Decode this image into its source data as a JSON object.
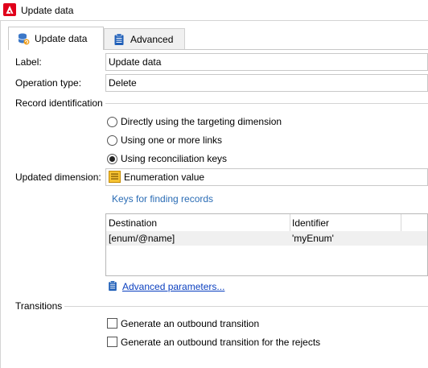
{
  "window": {
    "title": "Update data"
  },
  "tabs": [
    {
      "label": "Update data",
      "icon": "database-update-icon",
      "active": true
    },
    {
      "label": "Advanced",
      "icon": "clipboard-icon",
      "active": false
    }
  ],
  "form": {
    "label_caption": "Label:",
    "label_value": "Update data",
    "operation_caption": "Operation type:",
    "operation_value": "Delete"
  },
  "record_identification": {
    "title": "Record identification",
    "options": [
      {
        "label": "Directly using the targeting dimension",
        "selected": false
      },
      {
        "label": "Using one or more links",
        "selected": false
      },
      {
        "label": "Using reconciliation keys",
        "selected": true
      }
    ]
  },
  "dimension": {
    "caption": "Updated dimension:",
    "value": "Enumeration value",
    "icon": "enumeration-table-icon"
  },
  "keys": {
    "link_label": "Keys for finding records",
    "columns": [
      "Destination",
      "Identifier"
    ],
    "rows": [
      {
        "destination": "[enum/@name]",
        "identifier": "'myEnum'"
      }
    ]
  },
  "advanced_link": "Advanced parameters...",
  "transitions": {
    "title": "Transitions",
    "options": [
      {
        "label": "Generate an outbound transition",
        "checked": false
      },
      {
        "label": "Generate an outbound transition for the rejects",
        "checked": false
      }
    ]
  },
  "colors": {
    "accent_red": "#e0001b",
    "link_blue": "#0a3fbf",
    "keys_blue": "#2a6cb5"
  }
}
